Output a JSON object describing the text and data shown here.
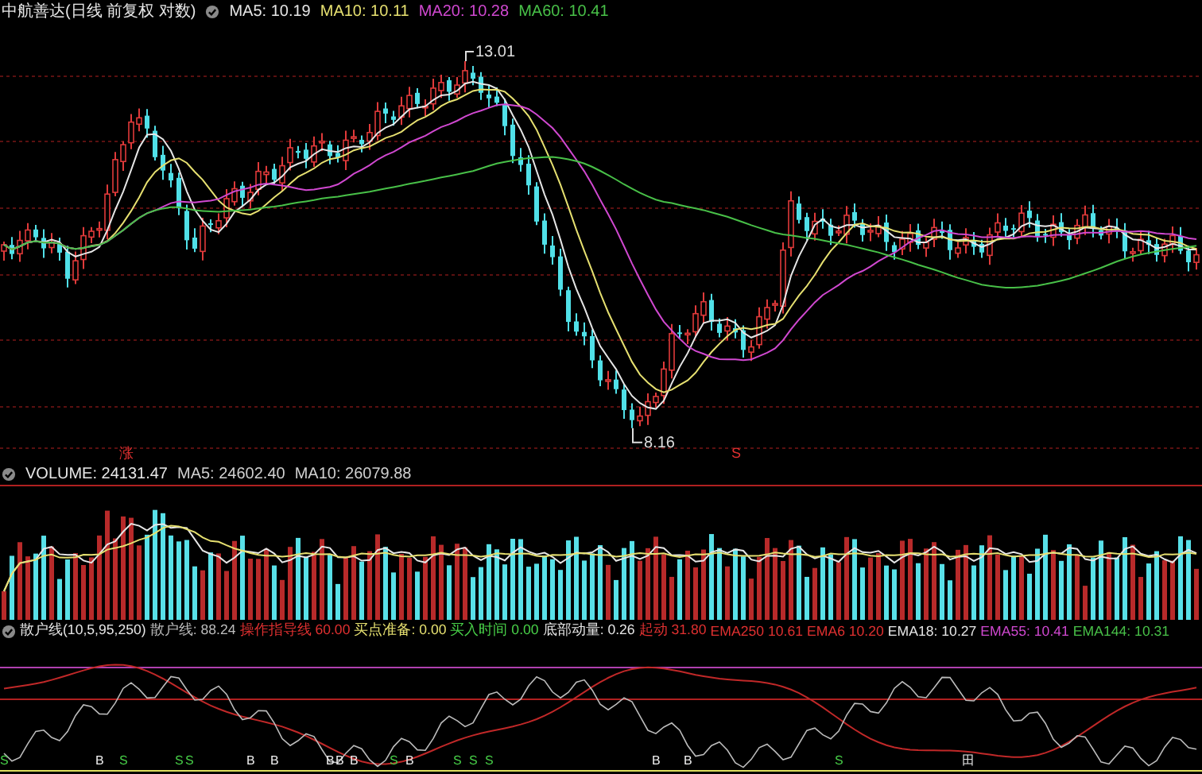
{
  "price_panel": {
    "title": "中航善达(日线 前复权 对数)",
    "indicators": [
      {
        "text": "MA5: 10.19",
        "color": "#e6e6e6"
      },
      {
        "text": "MA10: 10.11",
        "color": "#e6e070"
      },
      {
        "text": "MA20: 10.28",
        "color": "#d048d0"
      },
      {
        "text": "MA60: 10.41",
        "color": "#48c048"
      }
    ],
    "high_label": "13.01",
    "low_label": "8.16",
    "marks": [
      {
        "label": "涨"
      },
      {
        "label": "S"
      }
    ]
  },
  "volume_panel": {
    "indicators": [
      {
        "text": "VOLUME: 24131.47",
        "color": "#e6e6e6"
      },
      {
        "text": "MA5: 24602.40",
        "color": "#d0d0d0"
      },
      {
        "text": "MA10: 26079.88",
        "color": "#d0d0d0"
      }
    ]
  },
  "signal_panel": {
    "indicators": [
      {
        "text": "散户线(10,5,95,250)",
        "color": "#e6e6e6"
      },
      {
        "text": "散户线: 88.24",
        "color": "#bdbdbd"
      },
      {
        "text": "操作指导线 60.00",
        "color": "#e03030"
      },
      {
        "text": "买点准备: 0.00",
        "color": "#e6e070"
      },
      {
        "text": "买入时间 0.00",
        "color": "#48d048"
      },
      {
        "text": "底部动量: 0.26",
        "color": "#e6e6e6"
      },
      {
        "text": "起动 31.80",
        "color": "#e03030"
      },
      {
        "text": "EMA250 10.61",
        "color": "#e03030"
      },
      {
        "text": "EMA6 10.20",
        "color": "#e03030"
      },
      {
        "text": "EMA18: 10.27",
        "color": "#e6e6e6"
      },
      {
        "text": "EMA55: 10.41",
        "color": "#d048d0"
      },
      {
        "text": "EMA144: 10.31",
        "color": "#48c048"
      }
    ],
    "signals": [
      {
        "kind": "sell",
        "label": "S"
      },
      {
        "kind": "buy",
        "label": "B"
      },
      {
        "kind": "sell",
        "label": "S"
      },
      {
        "kind": "sell",
        "label": "S"
      },
      {
        "kind": "sell",
        "label": "S"
      },
      {
        "kind": "buy",
        "label": "B"
      },
      {
        "kind": "buy",
        "label": "B"
      },
      {
        "kind": "buy",
        "label": "B"
      },
      {
        "kind": "buy",
        "label": "B"
      },
      {
        "kind": "buy",
        "label": "B"
      },
      {
        "kind": "sell",
        "label": "S"
      },
      {
        "kind": "buy",
        "label": "B"
      },
      {
        "kind": "sell",
        "label": "S"
      },
      {
        "kind": "sell",
        "label": "S"
      },
      {
        "kind": "sell",
        "label": "S"
      },
      {
        "kind": "buy",
        "label": "B"
      },
      {
        "kind": "buy",
        "label": "B"
      },
      {
        "kind": "sell",
        "label": "S"
      },
      {
        "kind": "mark",
        "label": "田"
      }
    ]
  }
}
